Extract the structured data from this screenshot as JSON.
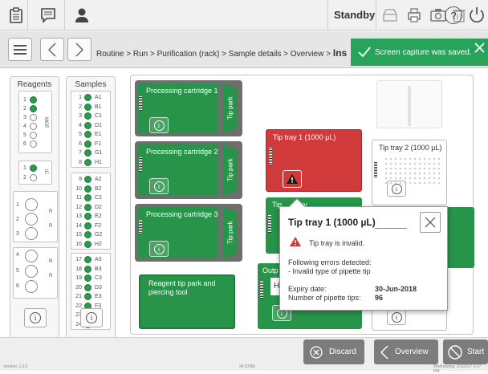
{
  "topbar": {
    "status": "Standby",
    "icons": [
      "clipboard-icon",
      "chat-icon",
      "user-icon",
      "tray-icon",
      "print-icon",
      "camera-icon",
      "trash-icon",
      "help-icon",
      "power-icon"
    ]
  },
  "nav": {
    "breadcrumb": "Routine > Run > Purification (rack) > Sample details > Overview > ",
    "breadcrumb_current": "Ins"
  },
  "toast": {
    "text": "Screen capture was saved.",
    "color": "#27a35a"
  },
  "reagents": {
    "title": "Reagents",
    "group1": [
      "1",
      "2",
      "3",
      "4",
      "5",
      "6"
    ],
    "group1_label": "MGP",
    "group2": [
      "1",
      "2"
    ],
    "group2_label": "IC",
    "group3": [
      "1",
      "2",
      "3"
    ],
    "group3_label": "R",
    "group4": [
      "4",
      "5",
      "6"
    ],
    "group4_label": "R"
  },
  "samples": {
    "title": "Samples",
    "items": [
      {
        "n": "1",
        "id": "A1"
      },
      {
        "n": "2",
        "id": "B1"
      },
      {
        "n": "3",
        "id": "C1"
      },
      {
        "n": "4",
        "id": "D1"
      },
      {
        "n": "5",
        "id": "E1"
      },
      {
        "n": "6",
        "id": "F1"
      },
      {
        "n": "7",
        "id": "G1"
      },
      {
        "n": "8",
        "id": "H1"
      },
      {
        "n": "9",
        "id": "A2"
      },
      {
        "n": "10",
        "id": "B2"
      },
      {
        "n": "11",
        "id": "C2"
      },
      {
        "n": "12",
        "id": "D2"
      },
      {
        "n": "13",
        "id": "E2"
      },
      {
        "n": "14",
        "id": "F2"
      },
      {
        "n": "15",
        "id": "G2"
      },
      {
        "n": "16",
        "id": "H2"
      },
      {
        "n": "17",
        "id": "A3"
      },
      {
        "n": "18",
        "id": "B3"
      },
      {
        "n": "19",
        "id": "C3"
      },
      {
        "n": "20",
        "id": "D3"
      },
      {
        "n": "21",
        "id": "E3"
      },
      {
        "n": "22",
        "id": "F3"
      },
      {
        "n": "23",
        "id": "G3"
      },
      {
        "n": "24",
        "id": "H3"
      }
    ]
  },
  "deck": {
    "cart1": "Processing cartridge 1",
    "cart2": "Processing cartridge 2",
    "cart3": "Processing cartridge 3",
    "tippark": "Tip park",
    "reagent_park": "Reagent tip park and piercing tool",
    "tiptray1": "Tip tray 1 (1000 µL)",
    "tiptray2": "Tip tray 2 (1000 µL)",
    "tiptray_partial": "Tip",
    "tiptray_partial2": "tray",
    "output_partial": "Outp",
    "hi_partial": "Hi"
  },
  "popup": {
    "title": "Tip tray 1 (1000 µL)",
    "warning": "Tip tray is invalid.",
    "errors_heading": "Following errors detected:",
    "error1": "- Invalid type of pipette tip",
    "expiry_label": "Expiry date:",
    "expiry_value": "30-Jun-2018",
    "tips_label": "Number of pipette tips:",
    "tips_value": "96"
  },
  "buttons": {
    "discard": "Discard",
    "overview": "Overview",
    "start": "Start"
  },
  "footer": {
    "version": "Version: 1.0.2",
    "center": "24.STAR",
    "datetime": "Wednesday, 2/1/2017 5:27 PM"
  },
  "colors": {
    "green": "#27944a",
    "red": "#d03a3a",
    "toast": "#27a35a"
  }
}
